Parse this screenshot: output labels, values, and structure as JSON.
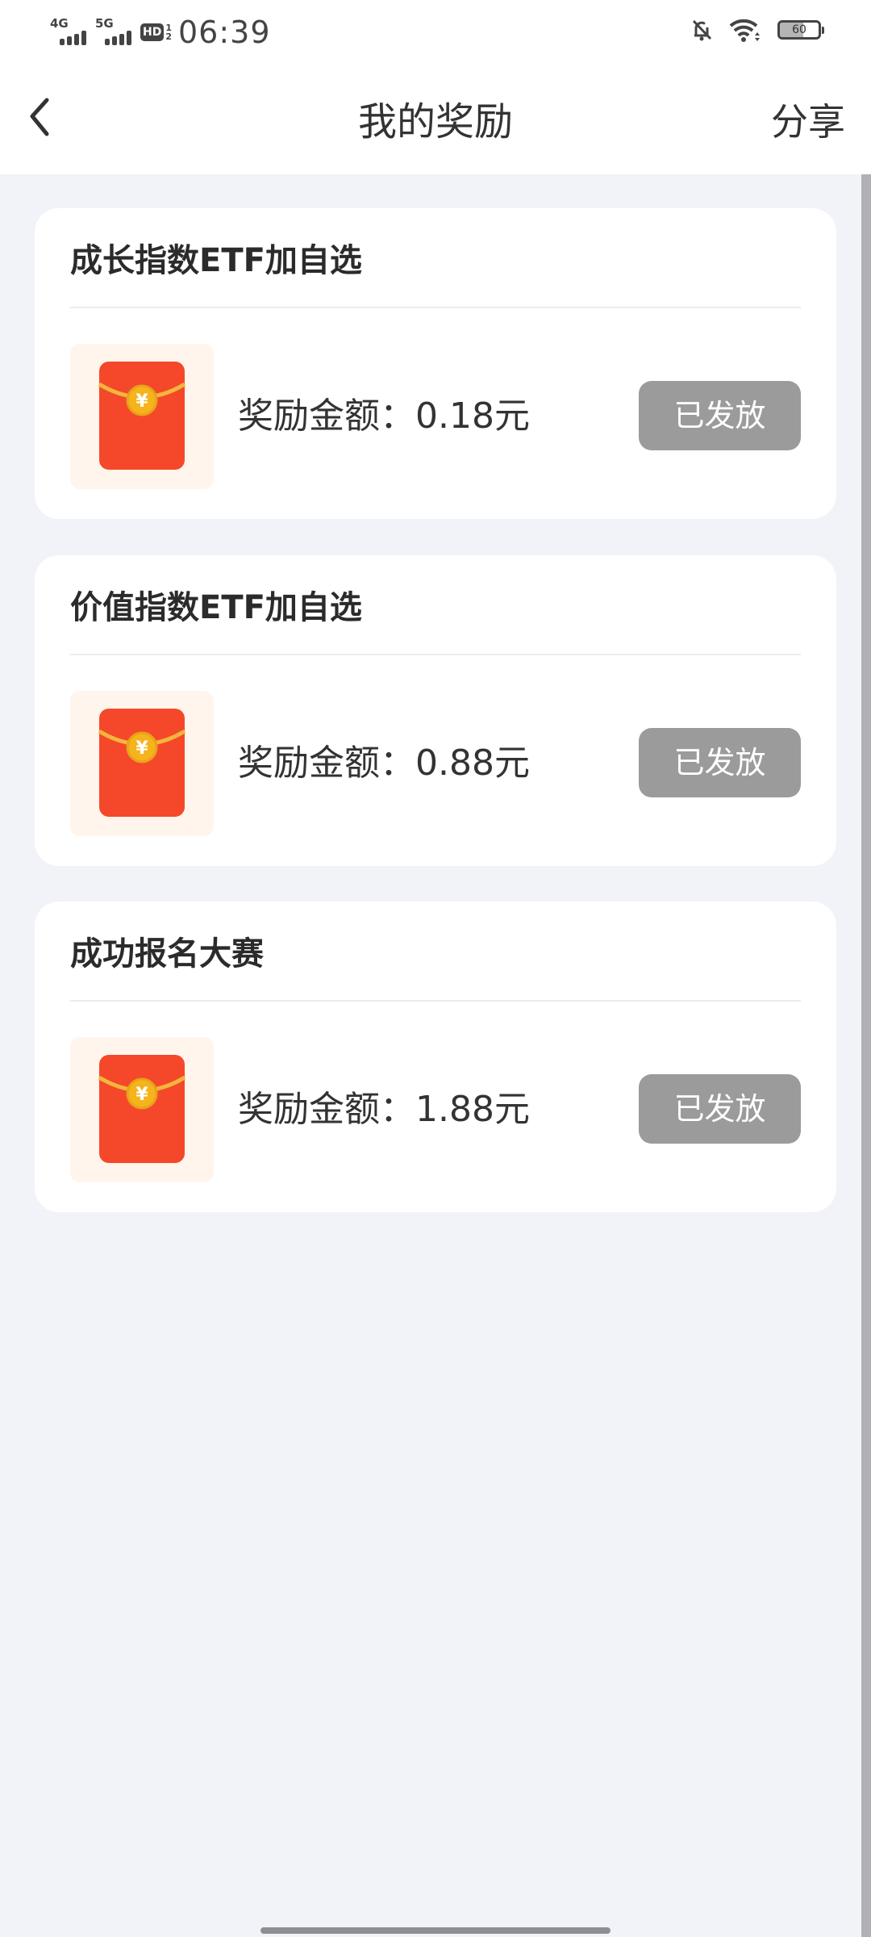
{
  "status_bar": {
    "network_1": "4G",
    "network_2": "5G",
    "hd_label": "HD",
    "hd_sub_top": "1",
    "hd_sub_bottom": "2",
    "time": "06:39",
    "icons": [
      "mute-bell-icon",
      "wifi-icon",
      "battery-icon"
    ],
    "battery_level": 60,
    "battery_text": "60"
  },
  "header": {
    "back_icon": "chevron-left-icon",
    "title": "我的奖励",
    "share_label": "分享"
  },
  "rewards": [
    {
      "title": "成长指数ETF加自选",
      "icon": "red-envelope-icon",
      "amount_label": "奖励金额：",
      "amount_value": "0.18元",
      "status": "已发放"
    },
    {
      "title": "价值指数ETF加自选",
      "icon": "red-envelope-icon",
      "amount_label": "奖励金额：",
      "amount_value": "0.88元",
      "status": "已发放"
    },
    {
      "title": "成功报名大赛",
      "icon": "red-envelope-icon",
      "amount_label": "奖励金额：",
      "amount_value": "1.88元",
      "status": "已发放"
    }
  ],
  "colors": {
    "page_bg": "#f2f3f8",
    "card_bg": "#ffffff",
    "envelope_red": "#f5482a",
    "coin_gold": "#f5b41c",
    "button_disabled": "#9b9b9b"
  }
}
